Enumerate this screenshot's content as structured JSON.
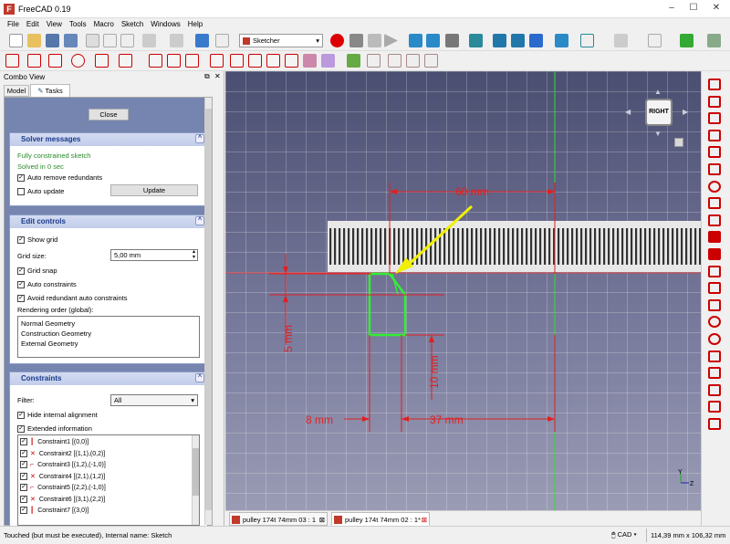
{
  "window": {
    "title": "FreeCAD 0.19",
    "logo": "F"
  },
  "menu": [
    "File",
    "Edit",
    "View",
    "Tools",
    "Macro",
    "Sketch",
    "Windows",
    "Help"
  ],
  "toolbar": {
    "workbench": "Sketcher"
  },
  "combo": {
    "title": "Combo View",
    "tabs": [
      "Model",
      "Tasks"
    ],
    "close_label": "Close",
    "solver": {
      "title": "Solver messages",
      "status": "Fully constrained sketch",
      "time": "Solved in 0 sec",
      "auto_remove": "Auto remove redundants",
      "auto_update": "Auto update",
      "update_btn": "Update"
    },
    "edit": {
      "title": "Edit controls",
      "show_grid": "Show grid",
      "grid_size_label": "Grid size:",
      "grid_size": "5,00 mm",
      "grid_snap": "Grid snap",
      "auto_constraints": "Auto constraints",
      "avoid_redundant": "Avoid redundant auto constraints",
      "rendering_label": "Rendering order (global):",
      "rendering": [
        "Normal Geometry",
        "Construction Geometry",
        "External Geometry"
      ]
    },
    "constraints": {
      "title": "Constraints",
      "filter_label": "Filter:",
      "filter_value": "All",
      "hide_internal": "Hide internal alignment",
      "extended": "Extended information",
      "items": [
        "Constraint1 [(0,0)]",
        "Constraint2 [(1,1),(0,2)]",
        "Constraint3 [(1,2),(-1,0)]",
        "Constraint4 [(2,1),(1,2)]",
        "Constraint5 [(2,2),(-1,0)]",
        "Constraint6 [(3,1),(2,2)]",
        "Constraint7 [(3,0)]"
      ]
    }
  },
  "viewport": {
    "navcube_label": "RIGHT",
    "dims": {
      "d60": "60 mm",
      "d5": "5 mm",
      "d10": "10 mm",
      "d8": "8 mm",
      "d37": "37 mm"
    },
    "axis_y": "Y",
    "axis_z": "Z"
  },
  "doc_tabs": [
    "pulley 174t 74mm 03 : 1",
    "pulley 174t 74mm 02 : 1*"
  ],
  "status": {
    "message": "Touched (but must be executed), Internal name: Sketch",
    "nav_style": "CAD",
    "dimensions": "114,39 mm x 106,32 mm"
  },
  "colors": {
    "accent": "#cc0000",
    "sketch_green": "#33dd33",
    "annotation_yellow": "#f0f000",
    "panel_header": "#1a3a8a"
  }
}
